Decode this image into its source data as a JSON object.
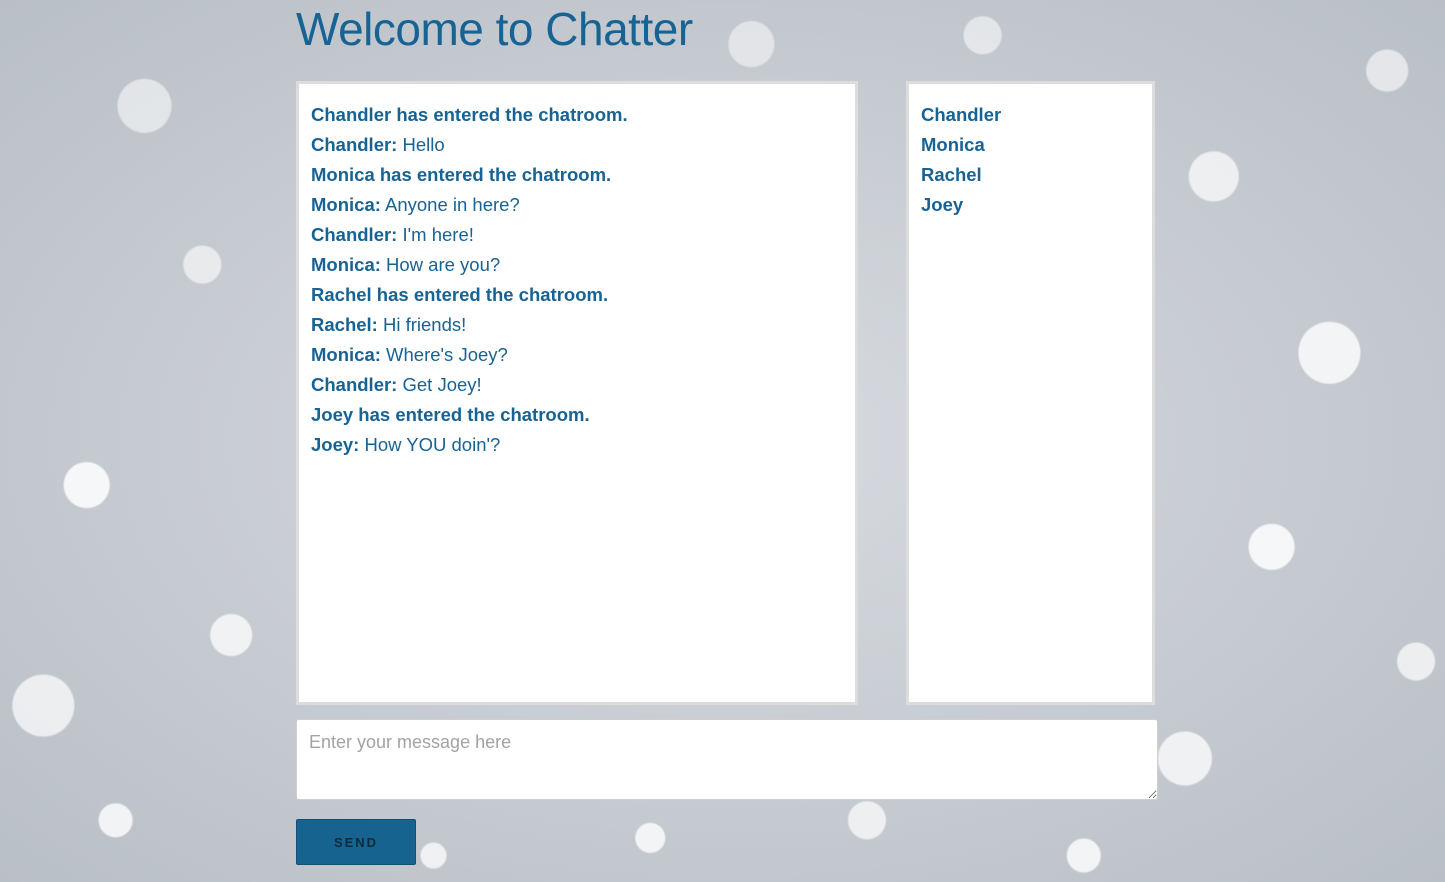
{
  "page": {
    "title": "Welcome to Chatter"
  },
  "chat": {
    "messages": [
      {
        "type": "system",
        "text": "Chandler has entered the chatroom."
      },
      {
        "type": "message",
        "sender": "Chandler:",
        "text": " Hello"
      },
      {
        "type": "system",
        "text": "Monica has entered the chatroom."
      },
      {
        "type": "message",
        "sender": "Monica:",
        "text": " Anyone in here?"
      },
      {
        "type": "message",
        "sender": "Chandler:",
        "text": " I'm here!"
      },
      {
        "type": "message",
        "sender": "Monica:",
        "text": " How are you?"
      },
      {
        "type": "system",
        "text": "Rachel has entered the chatroom."
      },
      {
        "type": "message",
        "sender": "Rachel:",
        "text": " Hi friends!"
      },
      {
        "type": "message",
        "sender": "Monica:",
        "text": " Where's Joey?"
      },
      {
        "type": "message",
        "sender": "Chandler:",
        "text": " Get Joey!"
      },
      {
        "type": "system",
        "text": "Joey has entered the chatroom."
      },
      {
        "type": "message",
        "sender": "Joey:",
        "text": " How YOU doin'?"
      }
    ]
  },
  "users": [
    "Chandler",
    "Monica",
    "Rachel",
    "Joey"
  ],
  "composer": {
    "placeholder": "Enter your message here",
    "value": "",
    "send_label": "SEND"
  },
  "colors": {
    "accent": "#176394",
    "panel_border": "#dcdcdc",
    "button_bg": "#17638f"
  }
}
